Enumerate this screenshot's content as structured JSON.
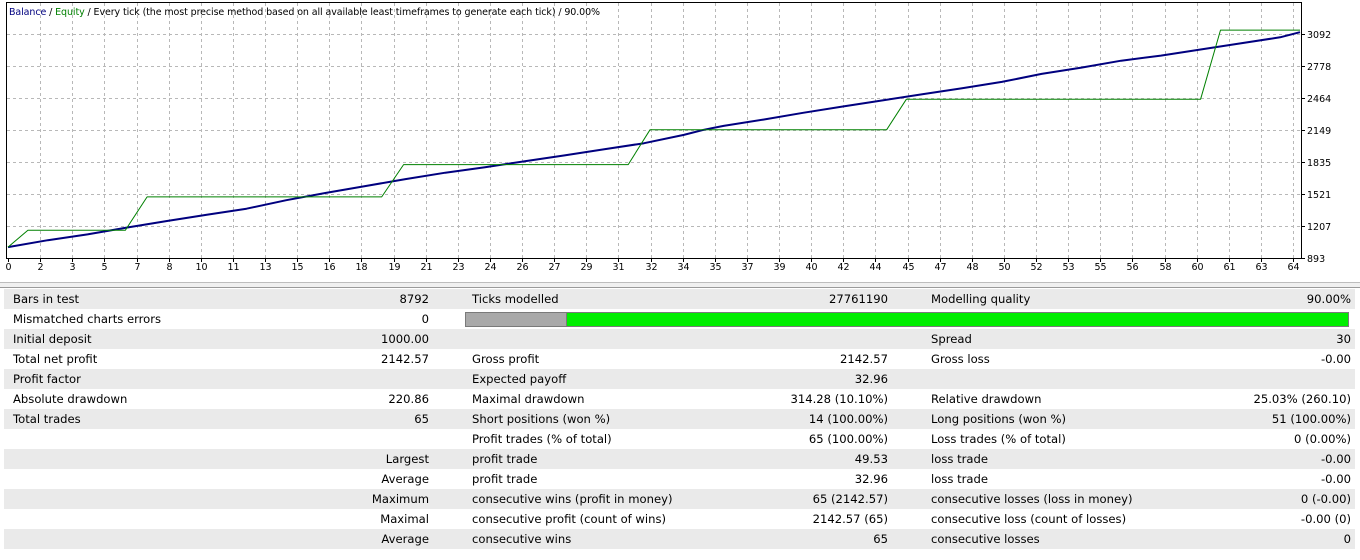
{
  "legend": {
    "balance": "Balance",
    "slash1": " / ",
    "equity": "Equity",
    "rest": " / Every tick (the most precise method based on all available least timeframes to generate each tick) / 90.00%"
  },
  "colors": {
    "balance": "#00007f",
    "equity": "#008000",
    "grid": "#b8b8b8",
    "quality_bar": "#00ee00",
    "quality_bar_empty": "#a9a9a9",
    "row_shade": "#eaeaea"
  },
  "chart_data": {
    "type": "line",
    "x_ticks": [
      "0",
      "2",
      "3",
      "5",
      "7",
      "8",
      "10",
      "11",
      "13",
      "15",
      "16",
      "18",
      "19",
      "21",
      "23",
      "24",
      "26",
      "27",
      "29",
      "31",
      "32",
      "34",
      "35",
      "37",
      "39",
      "40",
      "42",
      "44",
      "45",
      "47",
      "48",
      "50",
      "52",
      "53",
      "55",
      "56",
      "58",
      "60",
      "61",
      "63",
      "64"
    ],
    "y_ticks": [
      "3092",
      "2778",
      "2464",
      "2149",
      "1835",
      "1521",
      "1207",
      "893"
    ],
    "ylim": [
      893,
      3092
    ],
    "xlim": [
      0,
      65
    ],
    "grid": true,
    "series": [
      {
        "name": "Balance",
        "color": "#00007f",
        "x": [
          0,
          2,
          4,
          6,
          8,
          10,
          12,
          14,
          16,
          18,
          20,
          22,
          24,
          26,
          28,
          30,
          32,
          34,
          35,
          36,
          38,
          40,
          42,
          44,
          46,
          48,
          50,
          52,
          54,
          56,
          58,
          60,
          62,
          64,
          65
        ],
        "y": [
          1000,
          1068,
          1125,
          1192,
          1256,
          1317,
          1377,
          1460,
          1532,
          1600,
          1668,
          1730,
          1783,
          1843,
          1900,
          1960,
          2020,
          2101,
          2152,
          2190,
          2252,
          2318,
          2380,
          2440,
          2500,
          2560,
          2622,
          2700,
          2762,
          2830,
          2880,
          2940,
          3000,
          3060,
          3110
        ]
      },
      {
        "name": "Equity",
        "color": "#008000",
        "x": [
          0,
          1.0,
          5.9,
          7.0,
          18.8,
          19.9,
          31.2,
          32.3,
          44.2,
          45.2,
          60.0,
          61.0,
          65
        ],
        "y": [
          1000,
          1165,
          1165,
          1493,
          1493,
          1810,
          1810,
          2152,
          2152,
          2452,
          2452,
          3130,
          3130
        ]
      }
    ]
  },
  "report": {
    "rows": [
      [
        "Bars in test",
        "8792",
        "Ticks modelled",
        "27761190",
        "Modelling quality",
        "90.00%"
      ],
      [
        "Mismatched charts errors",
        "0",
        "",
        "",
        "",
        ""
      ],
      [
        "Initial deposit",
        "1000.00",
        "",
        "",
        "Spread",
        "30"
      ],
      [
        "Total net profit",
        "2142.57",
        "Gross profit",
        "2142.57",
        "Gross loss",
        "-0.00"
      ],
      [
        "Profit factor",
        "",
        "Expected payoff",
        "32.96",
        "",
        ""
      ],
      [
        "Absolute drawdown",
        "220.86",
        "Maximal drawdown",
        "314.28 (10.10%)",
        "Relative drawdown",
        "25.03% (260.10)"
      ],
      [
        "Total trades",
        "65",
        "Short positions (won %)",
        "14 (100.00%)",
        "Long positions (won %)",
        "51 (100.00%)"
      ],
      [
        "",
        "",
        "Profit trades (% of total)",
        "65 (100.00%)",
        "Loss trades (% of total)",
        "0 (0.00%)"
      ],
      [
        "",
        "Largest",
        "profit trade",
        "49.53",
        "loss trade",
        "-0.00"
      ],
      [
        "",
        "Average",
        "profit trade",
        "32.96",
        "loss trade",
        "-0.00"
      ],
      [
        "",
        "Maximum",
        "consecutive wins (profit in money)",
        "65 (2142.57)",
        "consecutive losses (loss in money)",
        "0 (-0.00)"
      ],
      [
        "",
        "Maximal",
        "consecutive profit (count of wins)",
        "2142.57 (65)",
        "consecutive loss (count of losses)",
        "-0.00 (0)"
      ],
      [
        "",
        "Average",
        "consecutive wins",
        "65",
        "consecutive losses",
        "0"
      ]
    ],
    "modelling_quality_fill": 0.9
  }
}
